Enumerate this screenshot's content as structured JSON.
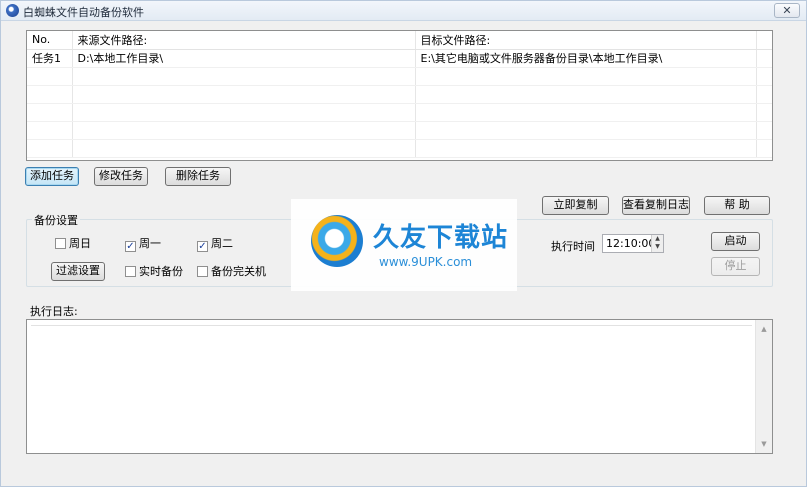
{
  "window": {
    "title": "白蜘蛛文件自动备份软件",
    "close_glyph": "✕"
  },
  "task_table": {
    "columns": [
      "No.",
      "来源文件路径:",
      "目标文件路径:"
    ],
    "rows": [
      {
        "no": "任务1",
        "source": "D:\\本地工作目录\\",
        "target": "E:\\其它电脑或文件服务器备份目录\\本地工作目录\\"
      }
    ]
  },
  "task_buttons": {
    "add": "添加任务",
    "edit": "修改任务",
    "delete": "删除任务"
  },
  "action_buttons": {
    "copy_now": "立即复制",
    "view_log": "查看复制日志",
    "help": "帮 助"
  },
  "backup_settings": {
    "group_label": "备份设置",
    "days": [
      {
        "label": "周日",
        "checked": false
      },
      {
        "label": "周一",
        "checked": true
      },
      {
        "label": "周二",
        "checked": true
      }
    ],
    "filter_button": "过滤设置",
    "realtime_backup": {
      "label": "实时备份",
      "checked": false
    },
    "shutdown_after": {
      "label": "备份完关机",
      "checked": false
    },
    "exec_time_label": "执行时间",
    "exec_time_value": "12:10:00",
    "start_button": "启动",
    "stop_button": "停止"
  },
  "log": {
    "label": "执行日志:"
  },
  "watermark": {
    "title": "久友下载站",
    "url": "www.9UPK.com"
  }
}
